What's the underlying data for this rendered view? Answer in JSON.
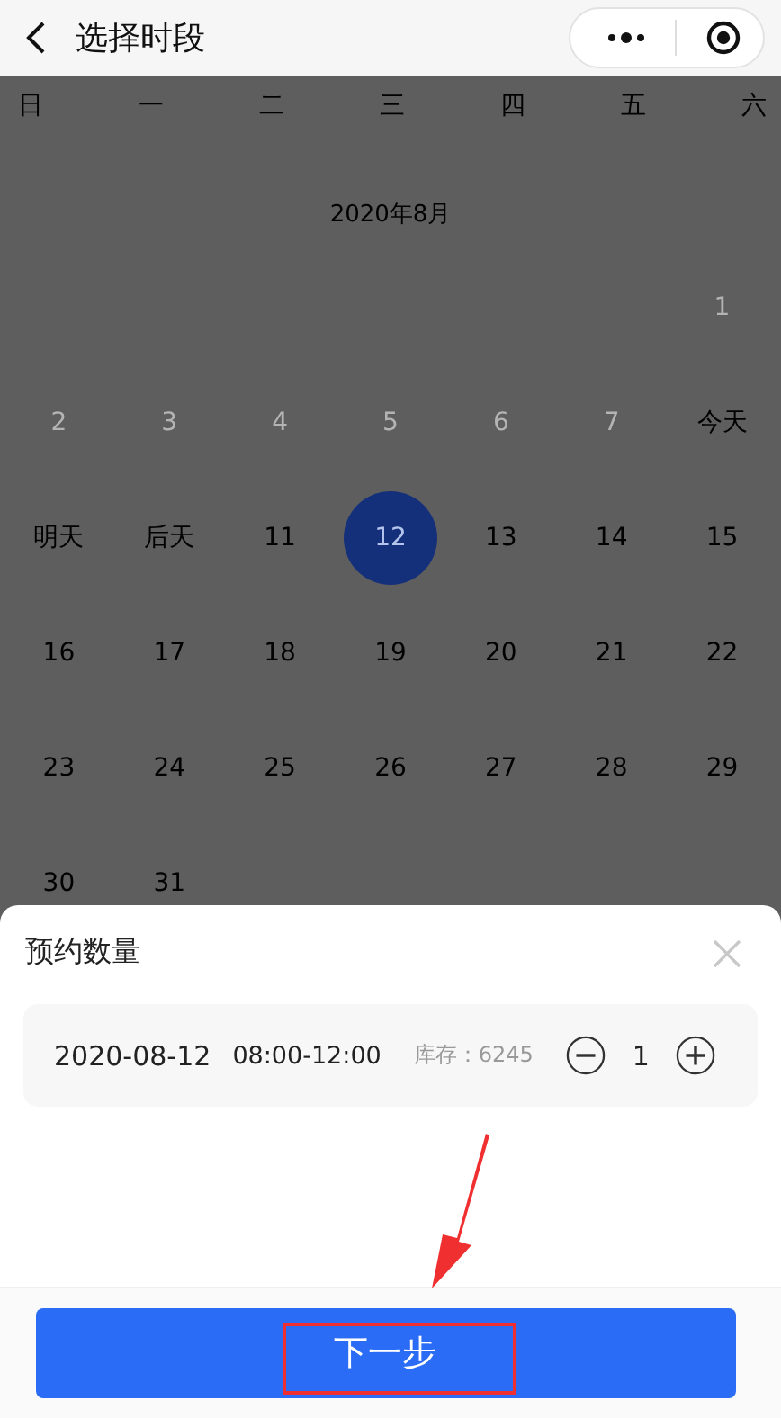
{
  "nav": {
    "title": "选择时段"
  },
  "weekdays": [
    "日",
    "一",
    "二",
    "三",
    "四",
    "五",
    "六"
  ],
  "month": "2020年8月",
  "days": [
    {
      "kind": "blank"
    },
    {
      "kind": "blank"
    },
    {
      "kind": "blank"
    },
    {
      "kind": "blank"
    },
    {
      "kind": "blank"
    },
    {
      "kind": "blank"
    },
    {
      "kind": "day",
      "label": "1",
      "disabled": true,
      "selected": false
    },
    {
      "kind": "day",
      "label": "2",
      "disabled": true,
      "selected": false
    },
    {
      "kind": "day",
      "label": "3",
      "disabled": true,
      "selected": false
    },
    {
      "kind": "day",
      "label": "4",
      "disabled": true,
      "selected": false
    },
    {
      "kind": "day",
      "label": "5",
      "disabled": true,
      "selected": false
    },
    {
      "kind": "day",
      "label": "6",
      "disabled": true,
      "selected": false
    },
    {
      "kind": "day",
      "label": "7",
      "disabled": true,
      "selected": false
    },
    {
      "kind": "day",
      "label": "今天",
      "disabled": false,
      "selected": false
    },
    {
      "kind": "day",
      "label": "明天",
      "disabled": false,
      "selected": false
    },
    {
      "kind": "day",
      "label": "后天",
      "disabled": false,
      "selected": false
    },
    {
      "kind": "day",
      "label": "11",
      "disabled": false,
      "selected": false
    },
    {
      "kind": "day",
      "label": "12",
      "disabled": false,
      "selected": true
    },
    {
      "kind": "day",
      "label": "13",
      "disabled": false,
      "selected": false
    },
    {
      "kind": "day",
      "label": "14",
      "disabled": false,
      "selected": false
    },
    {
      "kind": "day",
      "label": "15",
      "disabled": false,
      "selected": false
    },
    {
      "kind": "day",
      "label": "16",
      "disabled": false,
      "selected": false
    },
    {
      "kind": "day",
      "label": "17",
      "disabled": false,
      "selected": false
    },
    {
      "kind": "day",
      "label": "18",
      "disabled": false,
      "selected": false
    },
    {
      "kind": "day",
      "label": "19",
      "disabled": false,
      "selected": false
    },
    {
      "kind": "day",
      "label": "20",
      "disabled": false,
      "selected": false
    },
    {
      "kind": "day",
      "label": "21",
      "disabled": false,
      "selected": false
    },
    {
      "kind": "day",
      "label": "22",
      "disabled": false,
      "selected": false
    },
    {
      "kind": "day",
      "label": "23",
      "disabled": false,
      "selected": false
    },
    {
      "kind": "day",
      "label": "24",
      "disabled": false,
      "selected": false
    },
    {
      "kind": "day",
      "label": "25",
      "disabled": false,
      "selected": false
    },
    {
      "kind": "day",
      "label": "26",
      "disabled": false,
      "selected": false
    },
    {
      "kind": "day",
      "label": "27",
      "disabled": false,
      "selected": false
    },
    {
      "kind": "day",
      "label": "28",
      "disabled": false,
      "selected": false
    },
    {
      "kind": "day",
      "label": "29",
      "disabled": false,
      "selected": false
    },
    {
      "kind": "day",
      "label": "30",
      "disabled": false,
      "selected": false
    },
    {
      "kind": "day",
      "label": "31",
      "disabled": false,
      "selected": false
    }
  ],
  "sheet": {
    "title": "预约数量",
    "date": "2020-08-12",
    "time": "08:00-12:00",
    "stock": "库存：6245",
    "quantity": "1"
  },
  "button": "下一步"
}
